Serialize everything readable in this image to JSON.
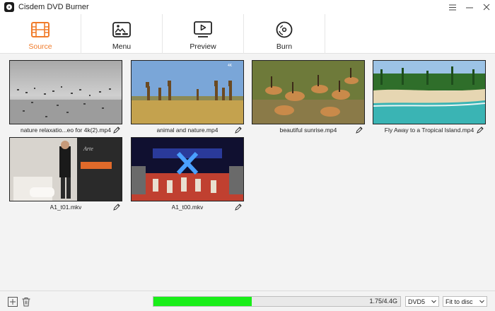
{
  "window": {
    "title": "Cisdem DVD Burner"
  },
  "nav": {
    "tabs": [
      {
        "label": "Source",
        "icon": "film-icon",
        "active": true
      },
      {
        "label": "Menu",
        "icon": "menu-template-icon",
        "active": false
      },
      {
        "label": "Preview",
        "icon": "play-screen-icon",
        "active": false
      },
      {
        "label": "Burn",
        "icon": "disc-icon",
        "active": false
      }
    ]
  },
  "videos": [
    {
      "name": "nature relaxatio...eo for 4k(2).mp4",
      "thumb": "birds-on-water"
    },
    {
      "name": "animal and nature.mp4",
      "thumb": "giraffes-savanna"
    },
    {
      "name": "beautiful sunrise.mp4",
      "thumb": "antelope-herd"
    },
    {
      "name": "Fly Away to a Tropical Island.mp4",
      "thumb": "tropical-beach"
    },
    {
      "name": "A1_t01.mkv",
      "thumb": "man-in-room"
    },
    {
      "name": "A1_t00.mkv",
      "thumb": "stage-show"
    }
  ],
  "bottom": {
    "capacity_text": "1.75/4.4G",
    "capacity_fraction": 0.397,
    "disc_type": "DVD5",
    "fit_mode": "Fit to disc"
  },
  "colors": {
    "accent": "#f07b2a",
    "progress": "#19ee19"
  }
}
